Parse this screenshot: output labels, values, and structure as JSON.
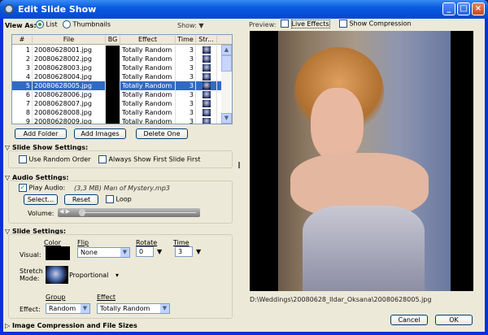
{
  "window": {
    "title": "Edit Slide Show"
  },
  "view_as": {
    "label": "View As:",
    "list": "List",
    "thumbnails": "Thumbnails",
    "show": "Show:"
  },
  "table": {
    "headers": [
      "#",
      "File",
      "BG",
      "Effect",
      "Time",
      "Str..."
    ],
    "rows": [
      {
        "n": "1",
        "file": "20080628001.jpg",
        "effect": "Totally Random",
        "time": "3"
      },
      {
        "n": "2",
        "file": "20080628002.jpg",
        "effect": "Totally Random",
        "time": "3"
      },
      {
        "n": "3",
        "file": "20080628003.jpg",
        "effect": "Totally Random",
        "time": "3"
      },
      {
        "n": "4",
        "file": "20080628004.jpg",
        "effect": "Totally Random",
        "time": "3"
      },
      {
        "n": "5",
        "file": "20080628005.jpg",
        "effect": "Totally Random",
        "time": "3"
      },
      {
        "n": "6",
        "file": "20080628006.jpg",
        "effect": "Totally Random",
        "time": "3"
      },
      {
        "n": "7",
        "file": "20080628007.jpg",
        "effect": "Totally Random",
        "time": "3"
      },
      {
        "n": "8",
        "file": "20080628008.jpg",
        "effect": "Totally Random",
        "time": "3"
      },
      {
        "n": "9",
        "file": "20080628009.jpg",
        "effect": "Totally Random",
        "time": "3"
      }
    ],
    "selected_index": 4
  },
  "buttons": {
    "add_folder": "Add Folder",
    "add_images": "Add Images",
    "delete_one": "Delete One",
    "select": "Select...",
    "reset": "Reset",
    "cancel": "Cancel",
    "ok": "OK"
  },
  "slideshow_settings": {
    "heading": "Slide Show Settings:",
    "random_order": "Use Random Order",
    "first_slide": "Always Show First Slide First"
  },
  "audio": {
    "heading": "Audio Settings:",
    "play_audio": "Play Audio:",
    "file": "(3,3 MB) Man of Mystery.mp3",
    "loop": "Loop",
    "volume": "Volume:",
    "volume_level": 0.03
  },
  "slide_settings": {
    "heading": "Slide Settings:",
    "visual": "Visual:",
    "color": "Color",
    "flip": "Flip",
    "flip_value": "None",
    "rotate": "Rotate",
    "rotate_value": "0",
    "time": "Time",
    "time_value": "3",
    "stretch_mode": "Stretch Mode:",
    "stretch_value": "Proportional",
    "effect_label": "Effect:",
    "group": "Group",
    "group_value": "Random",
    "effect": "Effect",
    "effect_value": "Totally Random"
  },
  "compression": {
    "heading": "Image Compression and File Sizes"
  },
  "preview": {
    "label": "Preview:",
    "live_effects": "Live Effects",
    "show_compression": "Show Compression",
    "path": "D:\\Weddings\\20080628_Ildar_Oksana\\20080628005.jpg"
  }
}
